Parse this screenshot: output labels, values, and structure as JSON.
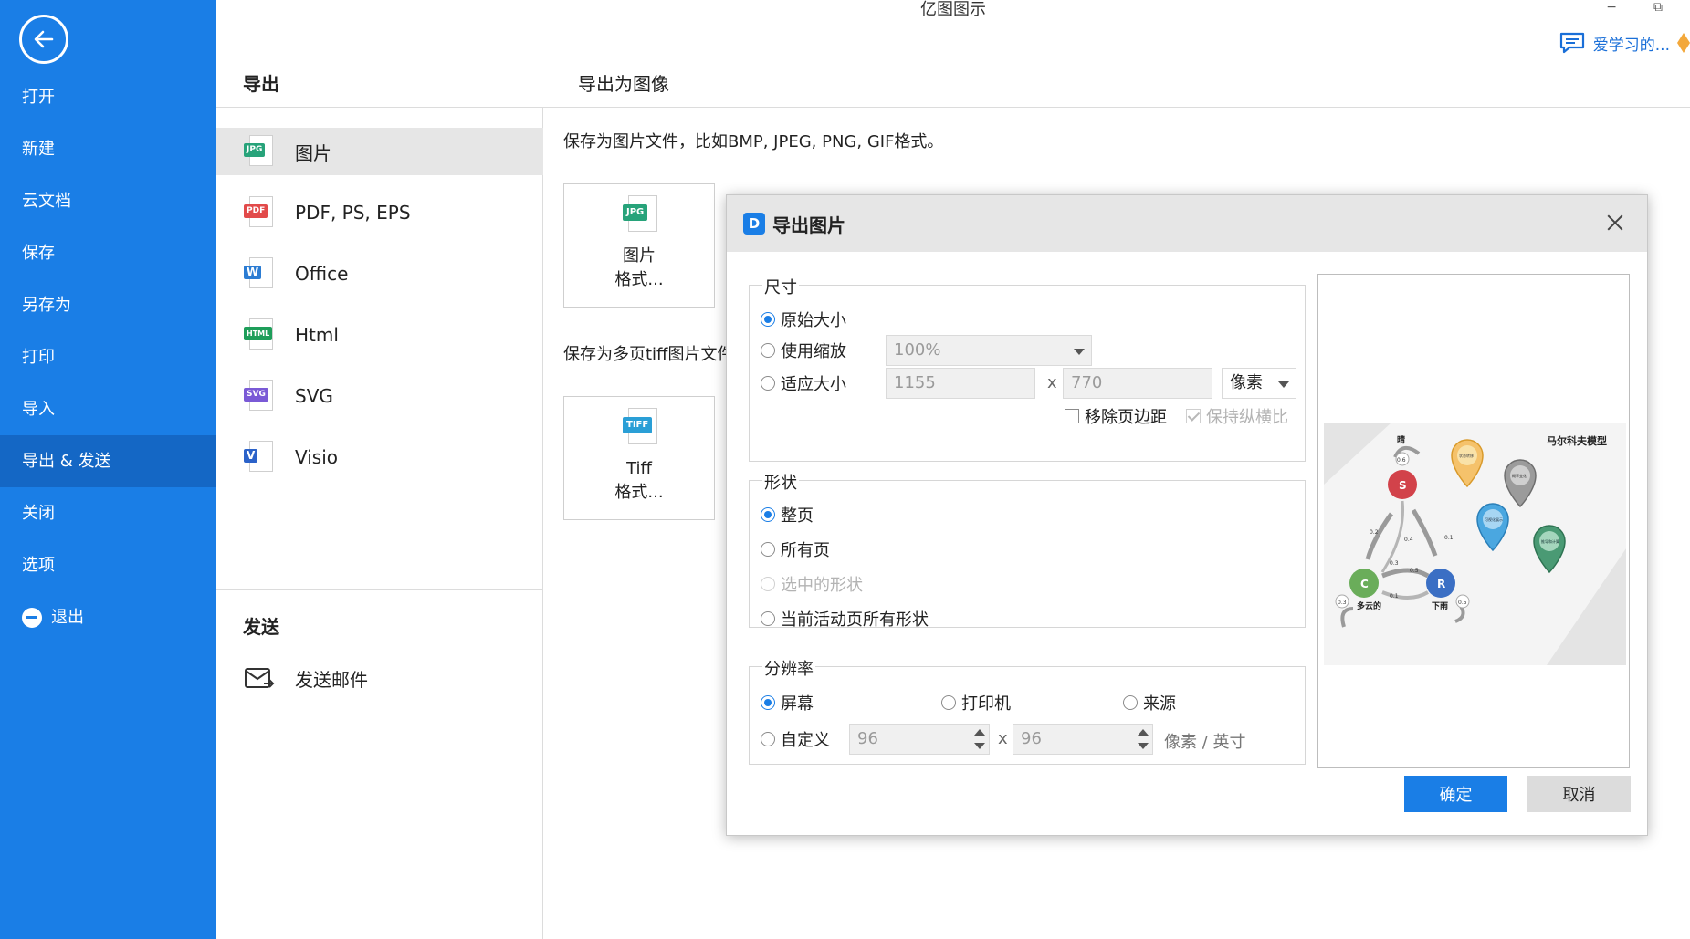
{
  "app": {
    "title": "亿图图示",
    "minimize": "−",
    "restore": "⧉",
    "user_label": "爱学习的..."
  },
  "sidebar": {
    "items": [
      {
        "label": "打开"
      },
      {
        "label": "新建"
      },
      {
        "label": "云文档"
      },
      {
        "label": "保存"
      },
      {
        "label": "另存为"
      },
      {
        "label": "打印"
      },
      {
        "label": "导入"
      },
      {
        "label": "导出 & 发送"
      },
      {
        "label": "关闭"
      },
      {
        "label": "选项"
      },
      {
        "label": "退出"
      }
    ],
    "active": "导出 & 发送"
  },
  "export": {
    "title": "导出",
    "formats": [
      {
        "label": "图片",
        "tag": "JPG",
        "color": "#27a37a"
      },
      {
        "label": "PDF, PS, EPS",
        "tag": "PDF",
        "color": "#e24a4a"
      },
      {
        "label": "Office",
        "tag": "W",
        "color": "#2b7cd3"
      },
      {
        "label": "Html",
        "tag": "HTML",
        "color": "#1e9e5a"
      },
      {
        "label": "SVG",
        "tag": "SVG",
        "color": "#7a5ad6"
      },
      {
        "label": "Visio",
        "tag": "V",
        "color": "#2b62c9"
      }
    ],
    "send_title": "发送",
    "send_email": "发送邮件"
  },
  "content": {
    "title": "导出为图像",
    "desc_image": "保存为图片文件，比如BMP, JPEG, PNG, GIF格式。",
    "desc_tiff": "保存为多页tiff图片文件",
    "card_image": {
      "tag": "JPG",
      "line1": "图片",
      "line2": "格式..."
    },
    "card_tiff": {
      "tag": "TIFF",
      "line1": "Tiff",
      "line2": "格式..."
    }
  },
  "dialog": {
    "title": "导出图片",
    "size": {
      "title": "尺寸",
      "original": "原始大小",
      "use_zoom": "使用缩放",
      "zoom_value": "100%",
      "fit_size": "适应大小",
      "width": "1155",
      "height": "770",
      "x": "x",
      "unit": "像素",
      "remove_margin": "移除页边距",
      "keep_ratio": "保持纵横比"
    },
    "shape": {
      "title": "形状",
      "whole_page": "整页",
      "all_pages": "所有页",
      "selected": "选中的形状",
      "current_all": "当前活动页所有形状"
    },
    "resolution": {
      "title": "分辨率",
      "screen": "屏幕",
      "printer": "打印机",
      "source": "来源",
      "custom": "自定义",
      "dpi_x": "96",
      "dpi_y": "96",
      "x": "x",
      "unit": "像素 / 英寸"
    },
    "preview": {
      "title": "马尔科夫模型",
      "states": {
        "s": "S",
        "c": "C",
        "r": "R"
      },
      "labels": {
        "sunny": "晴",
        "cloudy": "多云的",
        "rain": "下雨"
      },
      "probs": {
        "s_self": "0.6",
        "s_to_c": "0.2",
        "s_to_r": "0.1",
        "c_to_s": "0.3",
        "r_to_s": "0.4",
        "c_to_r": "0.5",
        "r_to_c": "0.1",
        "c_self": "0.3",
        "r_self": "0.5"
      },
      "pin_labels": {
        "orange": "状态转移",
        "gray": "概率变化",
        "blue": "可视化展示",
        "green": "推导和计算"
      }
    },
    "ok": "确定",
    "cancel": "取消"
  }
}
